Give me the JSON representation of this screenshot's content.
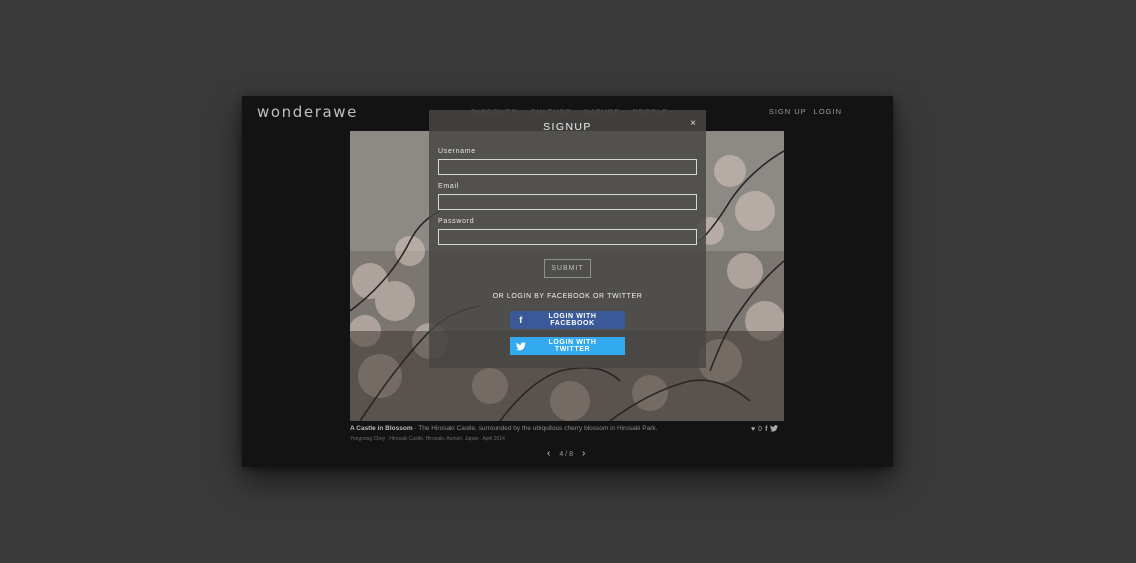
{
  "header": {
    "logo": "wonderawe",
    "nav": [
      "DISCOVER",
      "CULTURE",
      "NATURE",
      "PEOPLE"
    ],
    "signup_label": "SIGN UP",
    "login_label": "LOGIN"
  },
  "photo": {
    "caption_title": "A Castle in Blossom",
    "caption_text": " - The Hirosaki Castle, surrounded by the ubiquitous cherry blossom in Hirosaki Park.",
    "credit": "Yongcong Choy . Hirosaki Castle, Hirosaki, Aomori, Japan . April 2014",
    "likes": "0",
    "pager": "4 / 8"
  },
  "modal": {
    "title": "SIGNUP",
    "close": "×",
    "username_label": "Username",
    "username_value": "",
    "email_label": "Email",
    "email_value": "",
    "password_label": "Password",
    "password_value": "",
    "submit_label": "SUBMIT",
    "or_text": "OR LOGIN BY FACEBOOK OR TWITTER",
    "facebook_label": "LOGIN WITH FACEBOOK",
    "twitter_label": "LOGIN WITH TWITTER"
  },
  "colors": {
    "facebook": "#3b5998",
    "twitter": "#33aaf0",
    "page_bg": "#3a3a3a",
    "window_bg": "#131313"
  },
  "icons": [
    "facebook-icon",
    "twitter-icon",
    "heart-icon",
    "chevron-left-icon",
    "chevron-right-icon",
    "close-icon"
  ]
}
